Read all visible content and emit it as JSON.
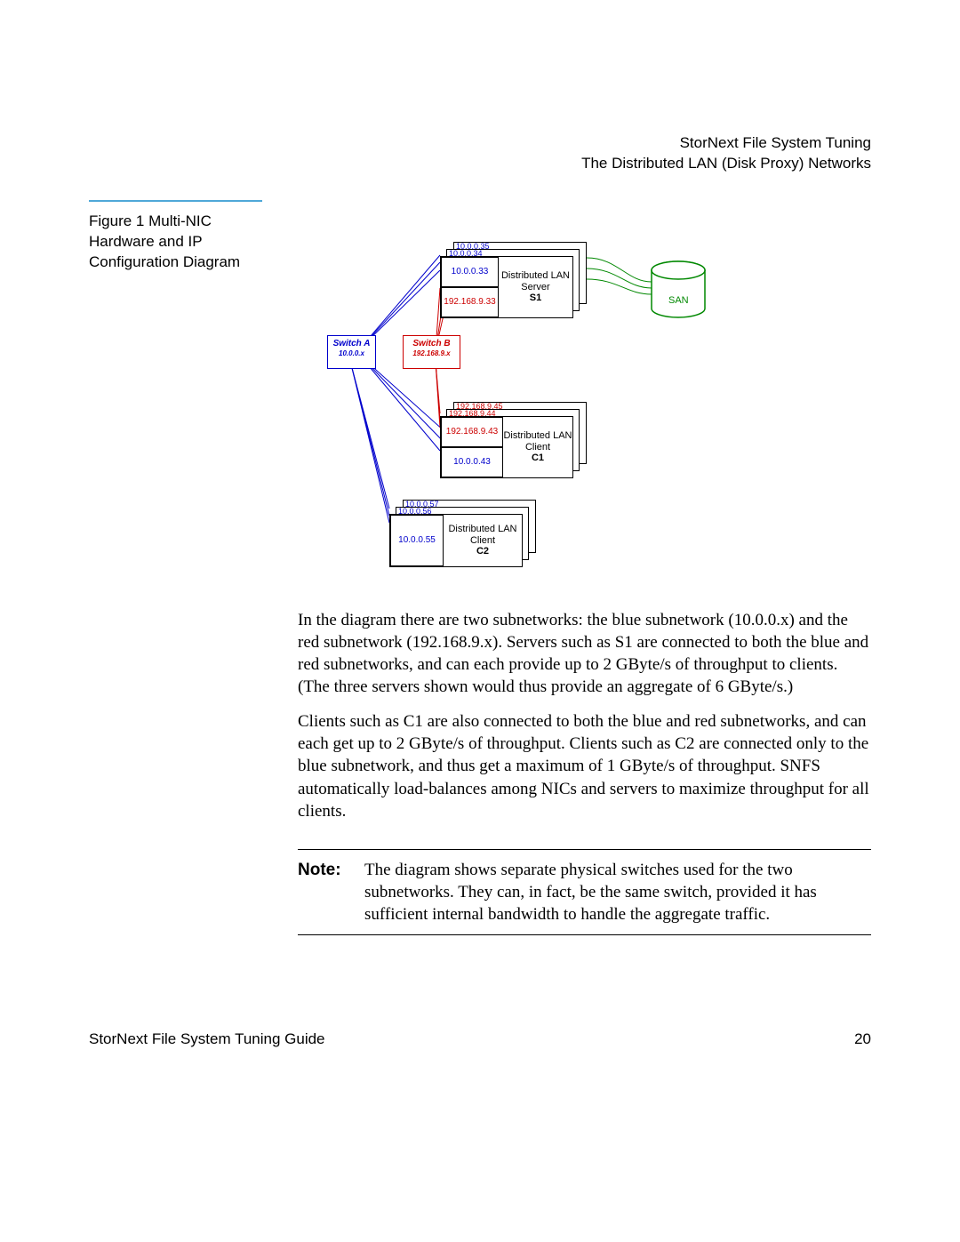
{
  "header": {
    "line1": "StorNext File System Tuning",
    "line2": "The Distributed LAN (Disk Proxy) Networks"
  },
  "figure_caption": "Figure 1  Multi-NIC Hardware and IP Configuration Diagram",
  "diagram": {
    "switch_a": {
      "name": "Switch A",
      "subnet": "10.0.0.x"
    },
    "switch_b": {
      "name": "Switch B",
      "subnet": "192.168.9.x"
    },
    "san": "SAN",
    "server_stack": {
      "label": "Distributed LAN Server",
      "id": "S1",
      "ips_blue": [
        "10.0.0.33",
        "10.0.0.34",
        "10.0.0.35"
      ],
      "ips_red": [
        "192.168.9.33"
      ]
    },
    "client1_stack": {
      "label": "Distributed LAN Client",
      "id": "C1",
      "ips_blue": [
        "10.0.0.43"
      ],
      "ips_red": [
        "192.168.9.43",
        "192.168.9.44",
        "192.168.9.45"
      ]
    },
    "client2_stack": {
      "label": "Distributed LAN Client",
      "id": "C2",
      "ips_blue": [
        "10.0.0.55",
        "10.0.0.56",
        "10.0.0.57"
      ]
    }
  },
  "body": {
    "p1": "In the diagram there are two subnetworks: the blue subnetwork (10.0.0.x) and the red subnetwork (192.168.9.x). Servers such as S1 are connected to both the blue and red subnetworks, and can each provide up to 2 GByte/s of throughput to clients. (The three servers shown would thus provide an aggregate of 6 GByte/s.)",
    "p2": "Clients such as C1 are also connected to both the blue and red subnetworks, and can each get up to 2 GByte/s of throughput. Clients such as C2 are connected only to the blue subnetwork, and thus get a maximum of 1 GByte/s of throughput.  SNFS automatically load-balances among NICs and servers to maximize throughput for all clients."
  },
  "note": {
    "label": "Note:",
    "text": "The diagram shows separate physical switches used for the two subnetworks. They can, in fact, be the same switch, provided it has sufficient internal bandwidth to handle the aggregate traffic."
  },
  "footer": {
    "left": "StorNext File System Tuning Guide",
    "page": "20"
  }
}
